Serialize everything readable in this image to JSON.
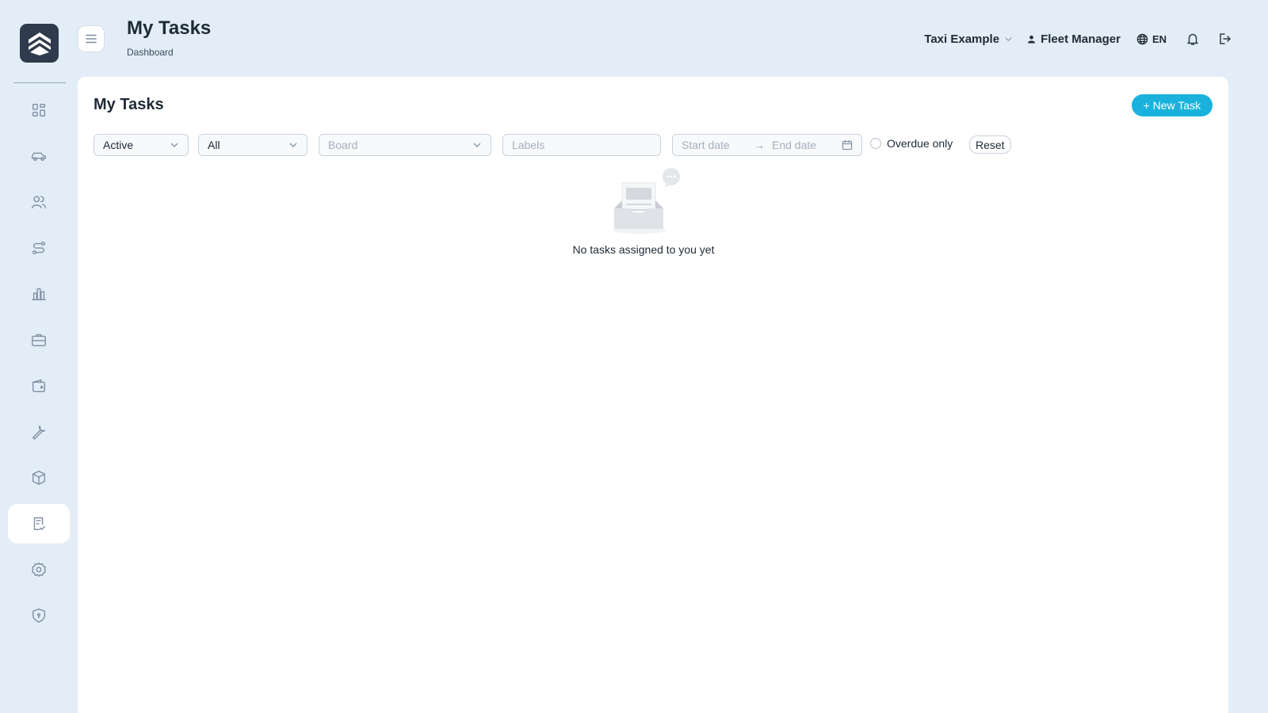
{
  "header": {
    "title": "My Tasks",
    "breadcrumb": "Dashboard",
    "company": "Taxi Example",
    "user": "Fleet Manager",
    "language": "EN"
  },
  "sidebar": {
    "items": [
      {
        "icon": "dashboard-icon",
        "active": false
      },
      {
        "icon": "car-icon",
        "active": false
      },
      {
        "icon": "users-icon",
        "active": false
      },
      {
        "icon": "route-icon",
        "active": false
      },
      {
        "icon": "bar-chart-icon",
        "active": false
      },
      {
        "icon": "briefcase-icon",
        "active": false
      },
      {
        "icon": "wallet-icon",
        "active": false
      },
      {
        "icon": "wrench-icon",
        "active": false
      },
      {
        "icon": "package-icon",
        "active": false
      },
      {
        "icon": "task-checklist-icon",
        "active": true
      },
      {
        "icon": "settings-icon",
        "active": false
      },
      {
        "icon": "shield-icon",
        "active": false
      }
    ]
  },
  "main": {
    "title": "My Tasks",
    "new_task_label": "+ New Task",
    "filters": {
      "status_value": "Active",
      "scope_value": "All",
      "board_placeholder": "Board",
      "labels_placeholder": "Labels",
      "start_date_placeholder": "Start date",
      "end_date_placeholder": "End date",
      "overdue_label": "Overdue only",
      "reset_label": "Reset"
    },
    "empty_message": "No tasks assigned to you yet"
  },
  "colors": {
    "background": "#e3edf7",
    "accent": "#1ab2dd",
    "logo_bg": "#2f3a4c"
  }
}
